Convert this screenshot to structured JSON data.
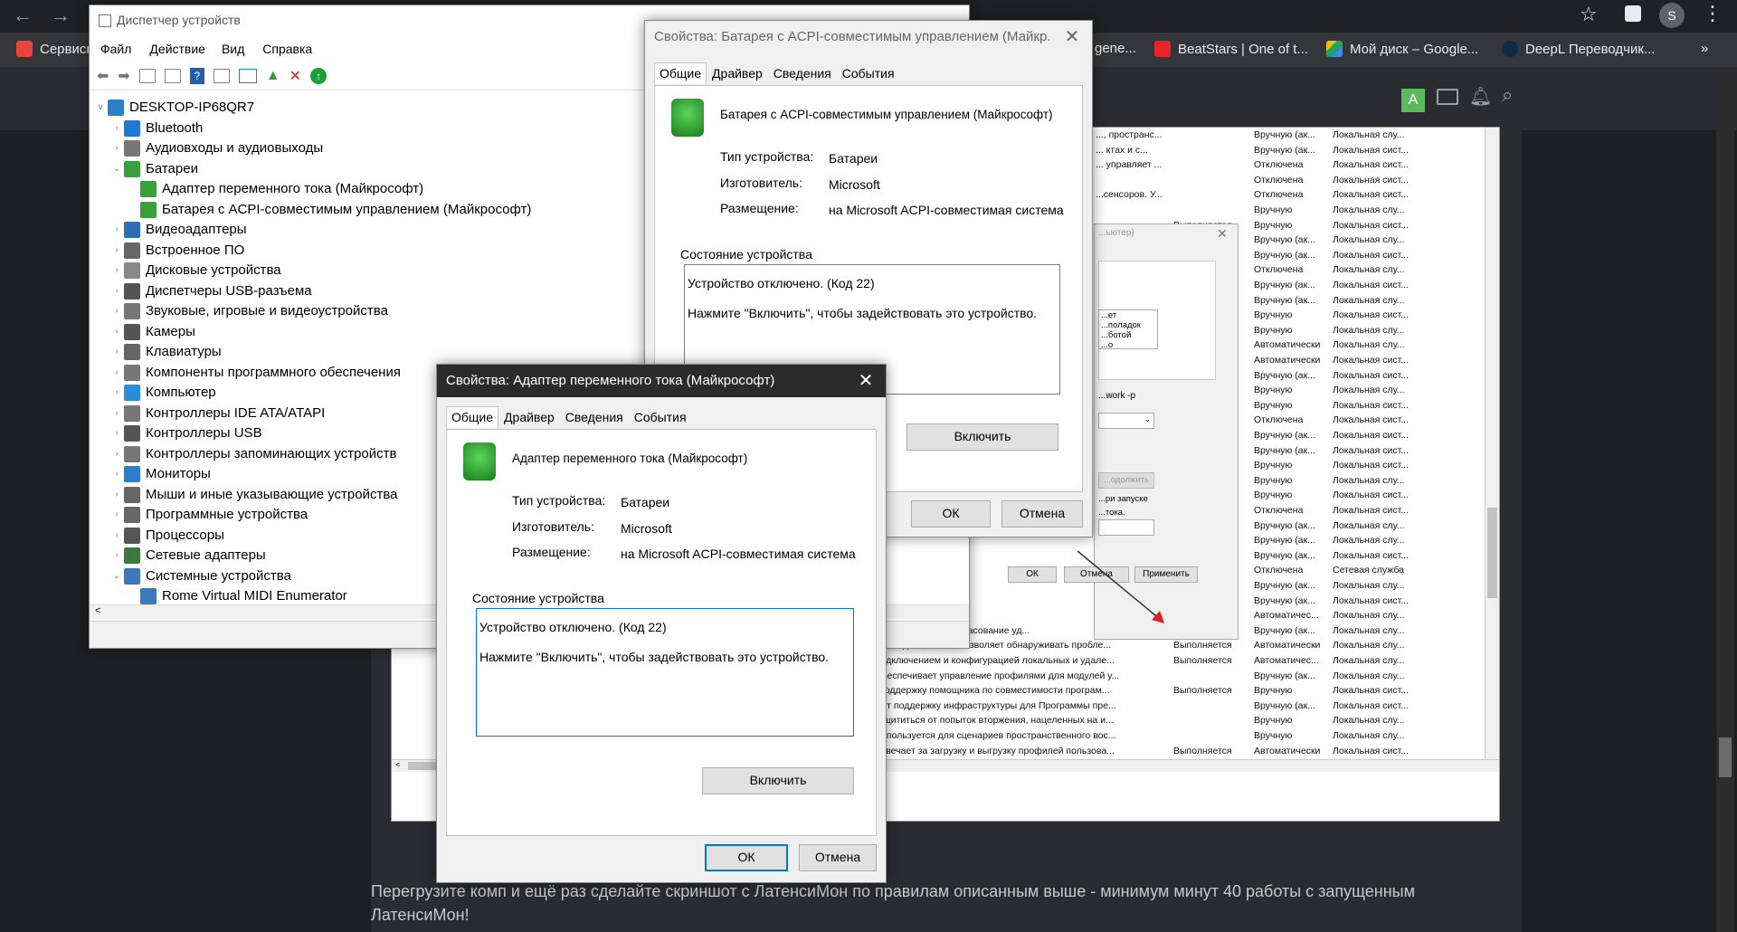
{
  "browser": {
    "bookmarks": [
      {
        "label": "Сервисы",
        "color": "#e8453c"
      },
      {
        "label": "gene...",
        "color": "#888888"
      },
      {
        "label": "BeatStars | One of t...",
        "color": "#e8252d"
      },
      {
        "label": "Мой диск – Google...",
        "color": "#1fa463"
      },
      {
        "label": "DeepL Переводчик...",
        "color": "#0f2b46"
      }
    ],
    "profile_initial": "S",
    "more_icon": "»"
  },
  "site_header": {
    "avatar_letter": "A"
  },
  "page_text": "Перегрузите комп и ещё раз сделайте скриншот с ЛатенсиМон по правилам описанным выше - минимум минут 40 работы с запущенным ЛатенсиМон!",
  "services": {
    "rows": [
      {
        "desc": "..., пространс...",
        "status": "",
        "start": "Вручную (ак...",
        "logon": "Локальная слу..."
      },
      {
        "desc": "... ктах и с...",
        "status": "",
        "start": "Вручную (ак...",
        "logon": "Локальная сист..."
      },
      {
        "desc": "... управляет ...",
        "status": "",
        "start": "Отключена",
        "logon": "Локальная сист..."
      },
      {
        "desc": "",
        "status": "",
        "start": "Отключена",
        "logon": "Локальная сист..."
      },
      {
        "desc": "...сенсоров. У...",
        "status": "",
        "start": "Отключена",
        "logon": "Локальная сист..."
      },
      {
        "desc": "",
        "status": "",
        "start": "Вручную",
        "logon": "Локальная слу..."
      },
      {
        "desc": "",
        "status": "Выполняется",
        "start": "Вручную",
        "logon": "Локальная сист..."
      },
      {
        "desc": "",
        "status": "",
        "start": "Вручную (ак...",
        "logon": "Локальная слу..."
      },
      {
        "desc": "",
        "status": "",
        "start": "Вручную (ак...",
        "logon": "Локальная сист..."
      },
      {
        "desc": "",
        "status": "",
        "start": "Отключена",
        "logon": "Локальная слу..."
      },
      {
        "desc": "",
        "status": "",
        "start": "Вручную (ак...",
        "logon": "Локальная сист..."
      },
      {
        "desc": "",
        "status": "",
        "start": "Вручную (ак...",
        "logon": "Локальная слу..."
      },
      {
        "desc": "",
        "status": "",
        "start": "Вручную",
        "logon": "Локальная сист..."
      },
      {
        "desc": "",
        "status": "",
        "start": "Вручную",
        "logon": "Локальная слу..."
      },
      {
        "desc": "",
        "status": "Выполняется",
        "start": "Автоматически",
        "logon": "Локальная слу..."
      },
      {
        "desc": "",
        "status": "Выполняется",
        "start": "Автоматически",
        "logon": "Локальная сист..."
      },
      {
        "desc": "",
        "status": "",
        "start": "Вручную (ак...",
        "logon": "Локальная сист..."
      },
      {
        "desc": "",
        "status": "",
        "start": "Вручную",
        "logon": "Локальная слу..."
      },
      {
        "desc": "",
        "status": "",
        "start": "Вручную",
        "logon": "Локальная сист..."
      },
      {
        "desc": "",
        "status": "",
        "start": "Отключена",
        "logon": "Локальная сист..."
      },
      {
        "desc": "",
        "status": "Выполняется",
        "start": "Вручную (ак...",
        "logon": "Локальная сист..."
      },
      {
        "desc": "",
        "status": "",
        "start": "Вручную (ак...",
        "logon": "Локальная сист..."
      },
      {
        "desc": "",
        "status": "",
        "start": "Вручную",
        "logon": "Локальная сист..."
      },
      {
        "desc": "",
        "status": "",
        "start": "Вручную",
        "logon": "Локальная слу..."
      },
      {
        "desc": "",
        "status": "",
        "start": "Вручную",
        "logon": "Локальная сист..."
      },
      {
        "desc": "",
        "status": "",
        "start": "Отключена",
        "logon": "Локальная сист..."
      },
      {
        "desc": "",
        "status": "",
        "start": "Вручную (ак...",
        "logon": "Локальная слу..."
      },
      {
        "desc": "",
        "status": "",
        "start": "Вручную (ак...",
        "logon": "Локальная слу..."
      },
      {
        "desc": "",
        "status": "",
        "start": "Вручную (ак...",
        "logon": "Локальная сист..."
      },
      {
        "desc": "",
        "status": "",
        "start": "Отключена",
        "logon": "Сетевая служба"
      },
      {
        "desc": "",
        "status": "",
        "start": "Вручную (ак...",
        "logon": "Локальная слу..."
      },
      {
        "desc": "",
        "status": "",
        "start": "Вручную (ак...",
        "logon": "Локальная сист..."
      },
      {
        "desc": "",
        "status": "Выполняется",
        "start": "Автоматичес...",
        "logon": "Локальная слу..."
      },
      {
        "desc": "...ивает обнаружение и согласование уд...",
        "status": "",
        "start": "Вручную (ак...",
        "logon": "Локальная слу..."
      },
      {
        "desc": "...а политики диагностики позволяет обнаруживать пробле...",
        "status": "Выполняется",
        "start": "Автоматически",
        "logon": "Локальная слу..."
      },
      {
        "desc": "...ение подключением и конфигурацией локальных и удале...",
        "status": "Выполняется",
        "start": "Автоматичес...",
        "logon": "Локальная слу..."
      },
      {
        "desc": "...ужба обеспечивает управление профилями для модулей у...",
        "status": "",
        "start": "Вручную (ак...",
        "logon": "Локальная слу..."
      },
      {
        "desc": "...ивает поддержку помощника по совместимости програм...",
        "status": "Выполняется",
        "start": "Вручную",
        "logon": "Локальная сист..."
      },
      {
        "desc": "...ставляет поддержку инфраструктуры для Программы пре...",
        "status": "",
        "start": "Вручную (ак...",
        "logon": "Локальная сист..."
      },
      {
        "desc": "...зяет защититься от попыток вторжения, нацеленных на и...",
        "status": "",
        "start": "Вручную",
        "logon": "Локальная слу..."
      },
      {
        "desc": "...ужба используется для сценариев пространственного вос...",
        "status": "",
        "start": "Вручную",
        "logon": "Локальная слу..."
      },
      {
        "desc": "...ужба отвечает за загрузку и выгрузку профилей пользова...",
        "status": "Выполняется",
        "start": "Автоматически",
        "logon": "Локальная сист..."
      },
      {
        "desc": "...ужба публикует имя компьютера посредством протокола ...",
        "status": "",
        "start": "Вручную",
        "logon": "Локальная слу..."
      }
    ],
    "bg_dialog": {
      "title_fragment": "...ьютер)",
      "list_lines": [
        "...ет",
        "...поладок",
        "...ботой",
        "...о"
      ],
      "cmd_fragment": "...work -p",
      "btn_pause": "...одолжить",
      "start_note": "...ри запуске",
      "note2": "...тока.",
      "ok": "ОК",
      "cancel": "Отмена",
      "apply": "Применить"
    }
  },
  "devmgr": {
    "title": "Диспетчер устройств",
    "menu": [
      "Файл",
      "Действие",
      "Вид",
      "Справка"
    ],
    "root": "DESKTOP-IP68QR7",
    "items": [
      {
        "label": "Bluetooth",
        "level": 1,
        "arrow": ">",
        "color": "#1e7ad6"
      },
      {
        "label": "Аудиовходы и аудиовыходы",
        "level": 1,
        "arrow": ">",
        "color": "#777"
      },
      {
        "label": "Батареи",
        "level": 1,
        "arrow": "v",
        "color": "#3aa03a"
      },
      {
        "label": "Адаптер переменного тока (Майкрософт)",
        "level": 2,
        "arrow": "",
        "color": "#3aa03a"
      },
      {
        "label": "Батарея с ACPI-совместимым управлением (Майкрософт)",
        "level": 2,
        "arrow": "",
        "color": "#3aa03a"
      },
      {
        "label": "Видеоадаптеры",
        "level": 1,
        "arrow": ">",
        "color": "#2a6fb8"
      },
      {
        "label": "Встроенное ПО",
        "level": 1,
        "arrow": ">",
        "color": "#666"
      },
      {
        "label": "Дисковые устройства",
        "level": 1,
        "arrow": ">",
        "color": "#888"
      },
      {
        "label": "Диспетчеры USB-разъема",
        "level": 1,
        "arrow": ">",
        "color": "#555"
      },
      {
        "label": "Звуковые, игровые и видеоустройства",
        "level": 1,
        "arrow": ">",
        "color": "#777"
      },
      {
        "label": "Камеры",
        "level": 1,
        "arrow": ">",
        "color": "#555"
      },
      {
        "label": "Клавиатуры",
        "level": 1,
        "arrow": ">",
        "color": "#666"
      },
      {
        "label": "Компоненты программного обеспечения",
        "level": 1,
        "arrow": ">",
        "color": "#777"
      },
      {
        "label": "Компьютер",
        "level": 1,
        "arrow": ">",
        "color": "#2a8fd8"
      },
      {
        "label": "Контроллеры IDE ATA/ATAPI",
        "level": 1,
        "arrow": ">",
        "color": "#777"
      },
      {
        "label": "Контроллеры USB",
        "level": 1,
        "arrow": ">",
        "color": "#555"
      },
      {
        "label": "Контроллеры запоминающих устройств",
        "level": 1,
        "arrow": ">",
        "color": "#777"
      },
      {
        "label": "Мониторы",
        "level": 1,
        "arrow": ">",
        "color": "#2a7fc8"
      },
      {
        "label": "Мыши и иные указывающие устройства",
        "level": 1,
        "arrow": ">",
        "color": "#666"
      },
      {
        "label": "Программные устройства",
        "level": 1,
        "arrow": ">",
        "color": "#666"
      },
      {
        "label": "Процессоры",
        "level": 1,
        "arrow": ">",
        "color": "#555"
      },
      {
        "label": "Сетевые адаптеры",
        "level": 1,
        "arrow": ">",
        "color": "#3a7a3a"
      },
      {
        "label": "Системные устройства",
        "level": 1,
        "arrow": "v",
        "color": "#3a7ab8"
      },
      {
        "label": "Rome Virtual MIDI Enumerator",
        "level": 2,
        "arrow": "",
        "color": "#3a7ab8"
      }
    ]
  },
  "battery_dialog": {
    "title": "Свойства: Батарея с ACPI-совместимым управлением (Майкр...",
    "tabs": [
      "Общие",
      "Драйвер",
      "Сведения",
      "События"
    ],
    "device_name": "Батарея с ACPI-совместимым управлением (Майкрософт)",
    "type_label": "Тип устройства:",
    "type_value": "Батареи",
    "mfr_label": "Изготовитель:",
    "mfr_value": "Microsoft",
    "loc_label": "Размещение:",
    "loc_value": "на Microsoft ACPI-совместимая система",
    "status_group": "Состояние устройства",
    "status_line1": "Устройство отключено. (Код 22)",
    "status_line2": "Нажмите \"Включить\", чтобы задействовать это устройство.",
    "enable": "Включить",
    "ok": "ОК",
    "cancel": "Отмена"
  },
  "adapter_dialog": {
    "title": "Свойства: Адаптер переменного тока (Майкрософт)",
    "tabs": [
      "Общие",
      "Драйвер",
      "Сведения",
      "События"
    ],
    "device_name": "Адаптер переменного тока (Майкрософт)",
    "type_label": "Тип устройства:",
    "type_value": "Батареи",
    "mfr_label": "Изготовитель:",
    "mfr_value": "Microsoft",
    "loc_label": "Размещение:",
    "loc_value": "на Microsoft ACPI-совместимая система",
    "status_group": "Состояние устройства",
    "status_line1": "Устройство отключено. (Код 22)",
    "status_line2": "Нажмите \"Включить\", чтобы задействовать это устройство.",
    "enable": "Включить",
    "ok": "ОК",
    "cancel": "Отмена"
  }
}
